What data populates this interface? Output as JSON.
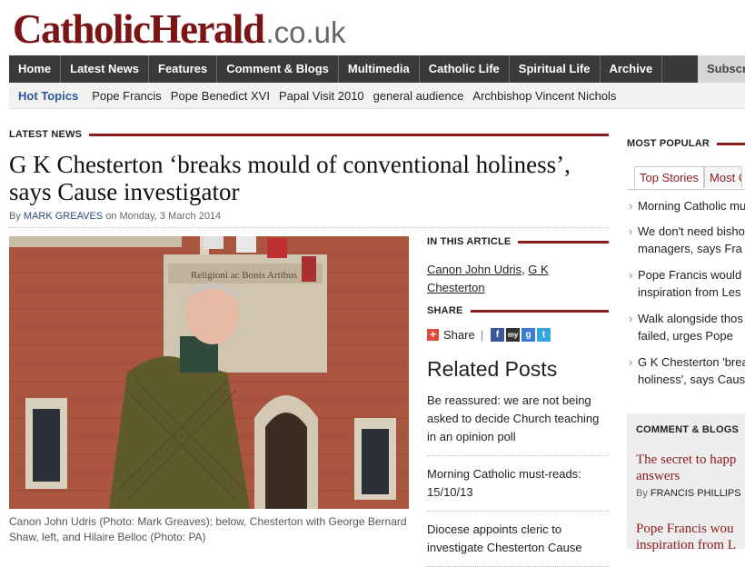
{
  "logo": {
    "main": "CatholicHerald",
    "tld": ".co.uk"
  },
  "nav": [
    "Home",
    "Latest News",
    "Features",
    "Comment & Blogs",
    "Multimedia",
    "Catholic Life",
    "Spiritual Life",
    "Archive"
  ],
  "nav_subscribe": "Subscr",
  "hot_topics_label": "Hot Topics",
  "topics": [
    "Pope Francis",
    "Pope Benedict XVI",
    "Papal Visit 2010",
    "general audience",
    "Archbishop Vincent Nichols"
  ],
  "latest_news_label": "LATEST NEWS",
  "article": {
    "headline": "G K Chesterton ‘breaks mould of conventional holiness’, says Cause investigator",
    "by": "By",
    "author": "MARK GREAVES",
    "date": "on Monday, 3 March 2014",
    "caption": "Canon John Udris (Photo: Mark Greaves); below, Chesterton with George Bernard Shaw, left, and Hilaire Belloc (Photo: PA)",
    "photo_signage": "Religioni ac Bonis Artibus"
  },
  "in_article_label": "IN THIS ARTICLE",
  "in_article_links": [
    "Canon John Udris",
    "G K Chesterton"
  ],
  "share_label": "SHARE",
  "share_button": "Share",
  "social_icons": [
    "f",
    "my",
    "g",
    "t"
  ],
  "related_title": "Related Posts",
  "related": [
    "Be reassured: we are not being asked to decide Church teaching in an opinion poll",
    "Morning Catholic must-reads: 15/10/13",
    "Diocese appoints cleric to investigate Chesterton Cause"
  ],
  "most_popular_label": "MOST POPULAR",
  "popular_tabs": [
    "Top Stories",
    "Most C"
  ],
  "popular_items": [
    [
      "Morning Catholic mus"
    ],
    [
      "We don't need bisho",
      "managers, says Fra"
    ],
    [
      "Pope Francis would",
      "inspiration from Les"
    ],
    [
      "Walk alongside thos",
      "failed, urges Pope"
    ],
    [
      "G K Chesterton 'brea",
      "holiness', says Caus"
    ]
  ],
  "comment_label": "COMMENT & BLOGS",
  "comment_items": [
    {
      "title1": "The secret to happ",
      "title2": "answers",
      "by": "By",
      "author": "FRANCIS PHILLIPS"
    },
    {
      "title1": "Pope Francis wou",
      "title2": "inspiration from L"
    }
  ],
  "colors": {
    "brand": "#7b1414",
    "accent": "#8a1c1c",
    "nav_bg": "#3a3a3a",
    "link_blue": "#2a5a9a"
  }
}
